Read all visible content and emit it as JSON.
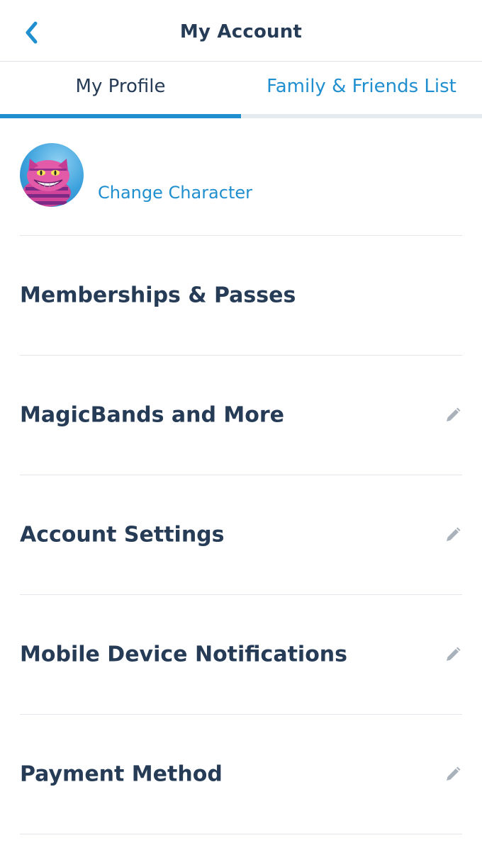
{
  "header": {
    "title": "My Account",
    "back_icon": "chevron-left-icon"
  },
  "tabs": [
    {
      "label": "My Profile",
      "active": true
    },
    {
      "label": "Family & Friends List",
      "active": false
    }
  ],
  "profile": {
    "change_character": "Change Character",
    "avatar": "cheshire-cat-avatar"
  },
  "menu": [
    {
      "label": "Memberships & Passes",
      "editable": false
    },
    {
      "label": "MagicBands and More",
      "editable": true
    },
    {
      "label": "Account Settings",
      "editable": true
    },
    {
      "label": "Mobile Device Notifications",
      "editable": true
    },
    {
      "label": "Payment Method",
      "editable": true
    }
  ],
  "colors": {
    "accent": "#1f8fd0",
    "text": "#253b56",
    "icon_gray": "#a9b1bb"
  }
}
